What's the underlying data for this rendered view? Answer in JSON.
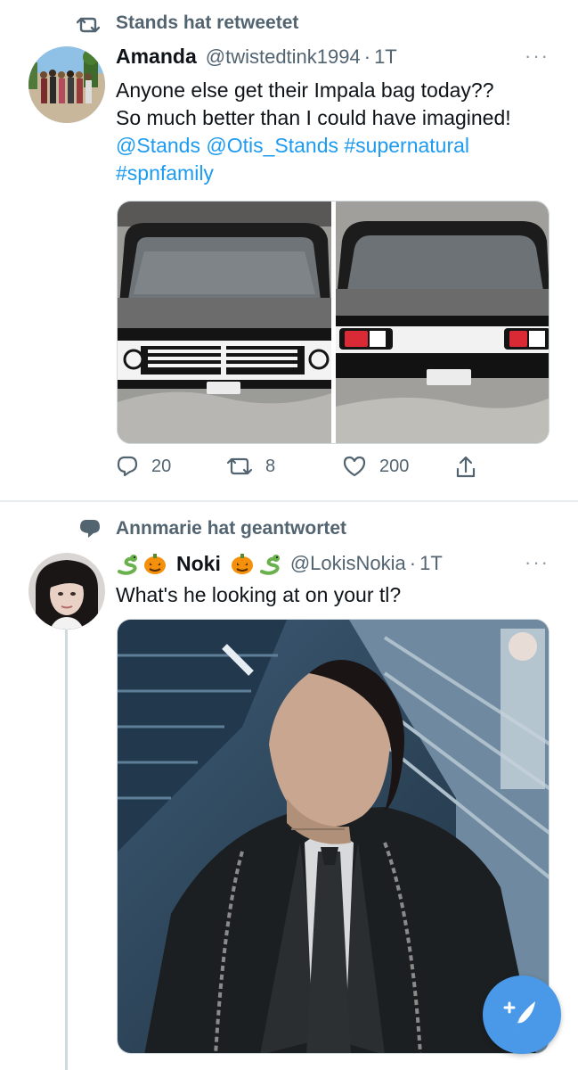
{
  "tweets": [
    {
      "social_context": "Stands hat retweetet",
      "author_name": "Amanda",
      "handle": "@twistedtink1994",
      "separator": "·",
      "time": "1T",
      "more": "···",
      "text_line1": "Anyone else get their Impala bag today??",
      "text_line2": "So much better than I could have imagined!",
      "links_line1": "@Stands @Otis_Stands #supernatural",
      "links_line2": "#spnfamily",
      "replies": "20",
      "retweets": "8",
      "likes": "200"
    },
    {
      "social_context": "Annmarie hat geantwortet",
      "author_name": "Noki",
      "name_emojis_left": [
        "snake-emoji",
        "pumpkin-emoji"
      ],
      "name_emojis_right": [
        "pumpkin-emoji",
        "snake-emoji"
      ],
      "handle": "@LokisNokia",
      "separator": "·",
      "time": "1T",
      "more": "···",
      "text": "What's he looking at on your tl?"
    }
  ],
  "icons": {
    "retweet": "retweet-icon",
    "reply_context": "speech-bubble-icon",
    "reply": "reply-icon",
    "like": "heart-icon",
    "share": "share-icon",
    "compose": "compose-tweet-icon"
  },
  "colors": {
    "link": "#1d9bf0",
    "secondary_text": "#536471",
    "fab": "#4a99e9"
  }
}
